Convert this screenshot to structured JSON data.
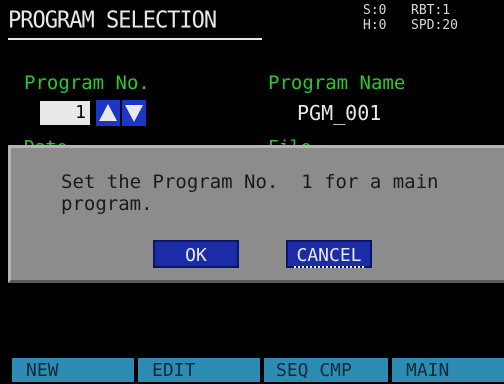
{
  "header": {
    "title": "PROGRAM SELECTION",
    "status_left": [
      "S:0",
      "H:0"
    ],
    "status_right": [
      "RBT:1",
      "SPD:20"
    ]
  },
  "program": {
    "no_label": "Program No.",
    "no_value": "1",
    "name_label": "Program Name",
    "name_value": "PGM_001",
    "hidden_label_left": "Date",
    "hidden_label_right": "File"
  },
  "dialog": {
    "message": "Set the Program No.  1 for a main\nprogram.",
    "ok_label": "OK",
    "cancel_label": "CANCEL"
  },
  "function_keys": {
    "indicator": "1",
    "keys": [
      "NEW",
      "EDIT",
      "SEQ CMP",
      "MAIN"
    ]
  },
  "colors": {
    "background": "#000000",
    "label_green": "#2cc82c",
    "button_blue": "#1c2ca8",
    "dialog_gray": "#8c8c8c",
    "fkey_cyan": "#2c8cb4",
    "fkey_indicator": "#e8c800"
  }
}
